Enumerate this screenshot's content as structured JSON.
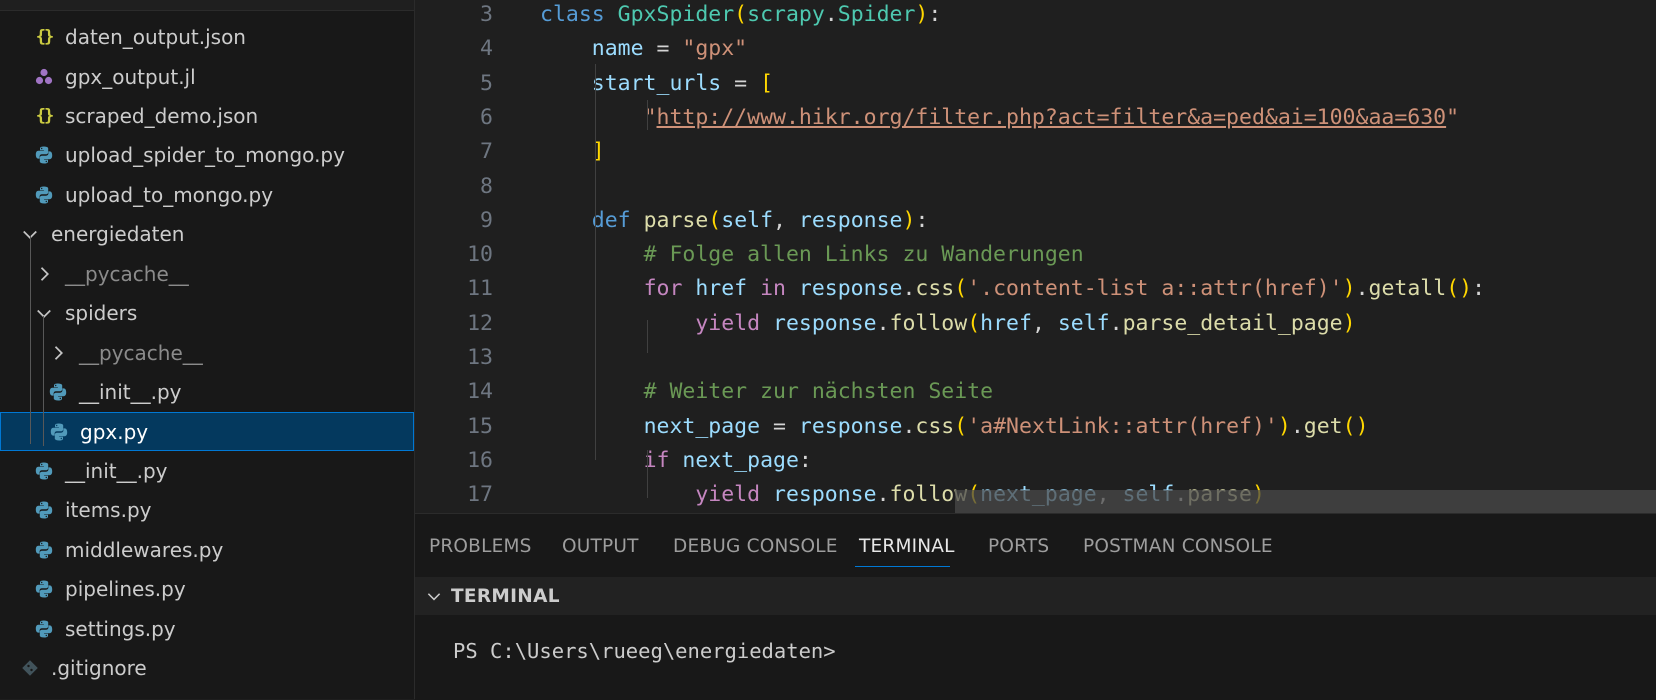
{
  "explorer": {
    "items": [
      {
        "label": "daten_output.json",
        "icon": "json-icon"
      },
      {
        "label": "gpx_output.jl",
        "icon": "jl-file-icon"
      },
      {
        "label": "scraped_demo.json",
        "icon": "json-icon"
      },
      {
        "label": "upload_spider_to_mongo.py",
        "icon": "python-icon"
      },
      {
        "label": "upload_to_mongo.py",
        "icon": "python-icon"
      },
      {
        "label": "energiedaten",
        "icon": "chevron-down-icon"
      },
      {
        "label": "__pycache__",
        "icon": "chevron-right-icon"
      },
      {
        "label": "spiders",
        "icon": "chevron-down-icon"
      },
      {
        "label": "__pycache__",
        "icon": "chevron-right-icon"
      },
      {
        "label": "__init__.py",
        "icon": "python-icon"
      },
      {
        "label": "gpx.py",
        "icon": "python-icon",
        "selected": true
      },
      {
        "label": "__init__.py",
        "icon": "python-icon"
      },
      {
        "label": "items.py",
        "icon": "python-icon"
      },
      {
        "label": "middlewares.py",
        "icon": "python-icon"
      },
      {
        "label": "pipelines.py",
        "icon": "python-icon"
      },
      {
        "label": "settings.py",
        "icon": "python-icon"
      },
      {
        "label": ".gitignore",
        "icon": "git-icon"
      }
    ]
  },
  "editor": {
    "line_numbers": [
      "3",
      "4",
      "5",
      "6",
      "7",
      "8",
      "9",
      "10",
      "11",
      "12",
      "13",
      "14",
      "15",
      "16",
      "17"
    ],
    "lines": [
      {
        "tokens": [
          [
            "kw",
            "class "
          ],
          [
            "cls",
            "GpxSpider"
          ],
          [
            "b1",
            "("
          ],
          [
            "cls",
            "scrapy"
          ],
          [
            "op",
            "."
          ],
          [
            "cls",
            "Spider"
          ],
          [
            "b1",
            ")"
          ],
          [
            "op",
            ":"
          ]
        ]
      },
      {
        "tokens": [
          [
            "op",
            "    "
          ],
          [
            "var",
            "name"
          ],
          [
            "op",
            " = "
          ],
          [
            "str",
            "\"gpx\""
          ]
        ]
      },
      {
        "tokens": [
          [
            "op",
            "    "
          ],
          [
            "var",
            "start_urls"
          ],
          [
            "op",
            " = "
          ],
          [
            "b1",
            "["
          ]
        ]
      },
      {
        "tokens": [
          [
            "op",
            "        "
          ],
          [
            "str",
            "\""
          ],
          [
            "url",
            "http://www.hikr.org/filter.php?act=filter&a=ped&ai=100&aa=630"
          ],
          [
            "str",
            "\""
          ]
        ]
      },
      {
        "tokens": [
          [
            "op",
            "    "
          ],
          [
            "b1",
            "]"
          ]
        ]
      },
      {
        "tokens": []
      },
      {
        "tokens": [
          [
            "op",
            "    "
          ],
          [
            "kw",
            "def "
          ],
          [
            "fn",
            "parse"
          ],
          [
            "b1",
            "("
          ],
          [
            "var",
            "self"
          ],
          [
            "op",
            ", "
          ],
          [
            "var",
            "response"
          ],
          [
            "b1",
            ")"
          ],
          [
            "op",
            ":"
          ]
        ]
      },
      {
        "tokens": [
          [
            "op",
            "        "
          ],
          [
            "cmt",
            "# Folge allen Links zu Wanderungen"
          ]
        ]
      },
      {
        "tokens": [
          [
            "op",
            "        "
          ],
          [
            "ctl",
            "for "
          ],
          [
            "var",
            "href"
          ],
          [
            "ctl",
            " in "
          ],
          [
            "var",
            "response"
          ],
          [
            "op",
            "."
          ],
          [
            "fn",
            "css"
          ],
          [
            "b1",
            "("
          ],
          [
            "str",
            "'.content-list a::attr(href)'"
          ],
          [
            "b1",
            ")"
          ],
          [
            "op",
            "."
          ],
          [
            "fn",
            "getall"
          ],
          [
            "b1",
            "()"
          ],
          [
            "op",
            ":"
          ]
        ]
      },
      {
        "tokens": [
          [
            "op",
            "            "
          ],
          [
            "ctl",
            "yield "
          ],
          [
            "var",
            "response"
          ],
          [
            "op",
            "."
          ],
          [
            "fn",
            "follow"
          ],
          [
            "b1",
            "("
          ],
          [
            "var",
            "href"
          ],
          [
            "op",
            ", "
          ],
          [
            "var",
            "self"
          ],
          [
            "op",
            "."
          ],
          [
            "fn",
            "parse_detail_page"
          ],
          [
            "b1",
            ")"
          ]
        ]
      },
      {
        "tokens": []
      },
      {
        "tokens": [
          [
            "op",
            "        "
          ],
          [
            "cmt",
            "# Weiter zur nächsten Seite"
          ]
        ]
      },
      {
        "tokens": [
          [
            "op",
            "        "
          ],
          [
            "var",
            "next_page"
          ],
          [
            "op",
            " = "
          ],
          [
            "var",
            "response"
          ],
          [
            "op",
            "."
          ],
          [
            "fn",
            "css"
          ],
          [
            "b1",
            "("
          ],
          [
            "str",
            "'a#NextLink::attr(href)'"
          ],
          [
            "b1",
            ")"
          ],
          [
            "op",
            "."
          ],
          [
            "fn",
            "get"
          ],
          [
            "b1",
            "()"
          ]
        ]
      },
      {
        "tokens": [
          [
            "op",
            "        "
          ],
          [
            "ctl",
            "if "
          ],
          [
            "var",
            "next_page"
          ],
          [
            "op",
            ":"
          ]
        ]
      },
      {
        "tokens": [
          [
            "op",
            "            "
          ],
          [
            "ctl",
            "yield "
          ],
          [
            "var",
            "response"
          ],
          [
            "op",
            "."
          ],
          [
            "fn",
            "follow"
          ],
          [
            "b1",
            "("
          ],
          [
            "var",
            "next_page"
          ],
          [
            "op",
            ", "
          ],
          [
            "var",
            "self"
          ],
          [
            "op",
            "."
          ],
          [
            "fn",
            "parse"
          ],
          [
            "b1",
            ")"
          ]
        ]
      }
    ]
  },
  "panel": {
    "tabs": [
      "PROBLEMS",
      "OUTPUT",
      "DEBUG CONSOLE",
      "TERMINAL",
      "PORTS",
      "POSTMAN CONSOLE"
    ],
    "active_tab": "TERMINAL",
    "section_title": "TERMINAL",
    "prompt": "PS C:\\Users\\rueeg\\energiedaten>"
  },
  "colors": {
    "selection_bg": "#04395e",
    "selection_border": "#0078d4",
    "active_tab_underline": "#0078d4"
  }
}
